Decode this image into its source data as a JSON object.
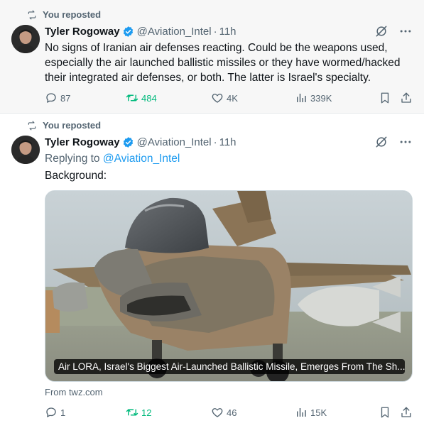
{
  "colors": {
    "accent": "#1d9bf0",
    "repost_green": "#00ba7c",
    "muted": "#536471",
    "text": "#0f1419"
  },
  "tweets": [
    {
      "repost_label": "You reposted",
      "author_name": "Tyler Rogoway",
      "handle": "@Aviation_Intel",
      "separator": "·",
      "time": "11h",
      "text": "No signs of Iranian air defenses reacting. Could be the weapons used, especially the air launched ballistic missiles or they have wormed/hacked their integrated air defenses, or both. The latter is Israel's specialty.",
      "stats": {
        "replies": "87",
        "reposts": "484",
        "likes": "4K",
        "views": "339K"
      }
    },
    {
      "repost_label": "You reposted",
      "author_name": "Tyler Rogoway",
      "handle": "@Aviation_Intel",
      "separator": "·",
      "time": "11h",
      "replying_prefix": "Replying to",
      "replying_to": "@Aviation_Intel",
      "text": "Background:",
      "card": {
        "caption": "Air LORA, Israel's Biggest Air-Launched Ballistic Missile, Emerges From The Sh...",
        "source": "From twz.com"
      },
      "stats": {
        "replies": "1",
        "reposts": "12",
        "likes": "46",
        "views": "15K"
      }
    }
  ],
  "icons": {
    "repost": "repost-icon",
    "verified": "verified-badge-icon",
    "grok": "grok-icon",
    "more": "more-icon",
    "reply": "reply-icon",
    "like": "heart-icon",
    "views": "views-icon",
    "bookmark": "bookmark-icon",
    "share": "share-icon"
  }
}
